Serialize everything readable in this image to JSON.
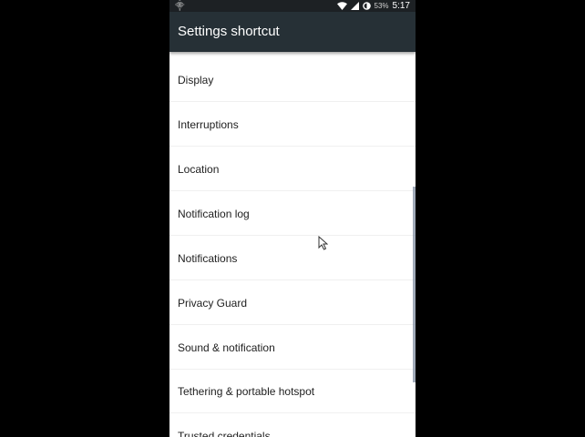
{
  "status_bar": {
    "left_icon": "notification-icon",
    "battery_percent": "53%",
    "time": "5:17",
    "icons": [
      "wifi-icon",
      "signal-icon",
      "battery-icon"
    ]
  },
  "app_bar": {
    "title": "Settings shortcut"
  },
  "list": {
    "items": [
      {
        "label": "Display"
      },
      {
        "label": "Interruptions"
      },
      {
        "label": "Location"
      },
      {
        "label": "Notification log"
      },
      {
        "label": "Notifications"
      },
      {
        "label": "Privacy Guard"
      },
      {
        "label": "Sound & notification"
      },
      {
        "label": "Tethering & portable hotspot"
      },
      {
        "label": "Trusted credentials"
      }
    ]
  }
}
